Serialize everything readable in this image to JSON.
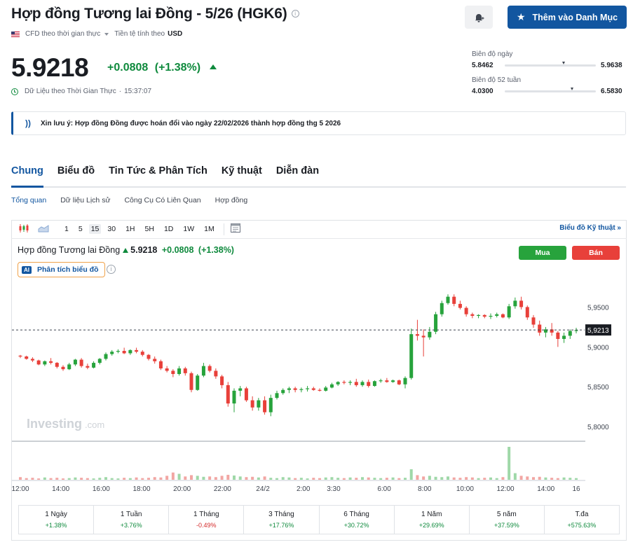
{
  "header": {
    "title": "Hợp đồng Tương lai Đồng - 5/26 (HGK6)",
    "source_label": "CFD theo thời gian thực",
    "currency_label": "Tiền tệ tính theo",
    "currency": "USD",
    "watchlist_button": "Thêm vào Danh Mục"
  },
  "quote": {
    "price": "5.9218",
    "change": "+0.0808",
    "change_pct": "(+1.38%)",
    "realtime_label": "Dữ Liệu theo Thời Gian Thực",
    "time": "15:37:07"
  },
  "ranges": {
    "day": {
      "label": "Biên độ ngày",
      "low": "5.8462",
      "high": "5.9638",
      "current_fraction": 0.65
    },
    "week52": {
      "label": "Biên độ 52 tuần",
      "low": "4.0300",
      "high": "6.5830",
      "current_fraction": 0.74
    }
  },
  "notice": {
    "text": "Xin lưu ý: Hợp đồng Đồng được hoán đổi vào ngày 22/02/2026 thành hợp đồng thg 5 2026"
  },
  "tabs": [
    "Chung",
    "Biểu đồ",
    "Tin Tức & Phân Tích",
    "Kỹ thuật",
    "Diễn đàn"
  ],
  "subtabs": [
    "Tổng quan",
    "Dữ liệu Lịch sử",
    "Công Cụ Có Liên Quan",
    "Hợp đồng"
  ],
  "toolbar": {
    "intervals": [
      "1",
      "5",
      "15",
      "30",
      "1H",
      "5H",
      "1D",
      "1W",
      "1M"
    ],
    "selected_interval": "15",
    "tech_chart_link": "Biểu đồ Kỹ thuật"
  },
  "chart_header": {
    "name": "Hợp đồng Tương lai Đồng",
    "price": "5.9218",
    "change": "+0.0808",
    "change_pct": "(+1.38%)",
    "buy": "Mua",
    "sell": "Bán",
    "ai_badge": "AI",
    "ai_label": "Phân tích biểu đồ",
    "watermark": "Investing",
    "watermark_suffix": ".com"
  },
  "chart_data": {
    "type": "candlestick",
    "interval": "15",
    "y_ticks": [
      "5,9500",
      "5,9000",
      "5,8500",
      "5,8000"
    ],
    "ylim": [
      5.786,
      5.975
    ],
    "x_ticks": [
      "12:00",
      "14:00",
      "16:00",
      "18:00",
      "20:00",
      "22:00",
      "24/2",
      "2:00",
      "3:30",
      "6:00",
      "8:00",
      "10:00",
      "12:00",
      "14:00",
      "16"
    ],
    "x_tick_positions": [
      0,
      4,
      8,
      12,
      16,
      20,
      24,
      28,
      31,
      36,
      40,
      44,
      48,
      52,
      55
    ],
    "current_price_label": "5,9213",
    "current_price": 5.9213,
    "candles": [
      [
        5.889,
        5.89,
        5.886,
        5.888
      ],
      [
        5.888,
        5.889,
        5.884,
        5.885
      ],
      [
        5.885,
        5.887,
        5.881,
        5.883
      ],
      [
        5.883,
        5.884,
        5.877,
        5.878
      ],
      [
        5.878,
        5.883,
        5.876,
        5.882
      ],
      [
        5.882,
        5.886,
        5.878,
        5.88
      ],
      [
        5.88,
        5.881,
        5.873,
        5.875
      ],
      [
        5.875,
        5.877,
        5.87,
        5.872
      ],
      [
        5.872,
        5.88,
        5.871,
        5.878
      ],
      [
        5.878,
        5.885,
        5.876,
        5.884
      ],
      [
        5.884,
        5.886,
        5.874,
        5.876
      ],
      [
        5.876,
        5.879,
        5.872,
        5.874
      ],
      [
        5.874,
        5.882,
        5.873,
        5.88
      ],
      [
        5.88,
        5.886,
        5.878,
        5.885
      ],
      [
        5.885,
        5.893,
        5.883,
        5.891
      ],
      [
        5.891,
        5.896,
        5.889,
        5.894
      ],
      [
        5.894,
        5.897,
        5.892,
        5.895
      ],
      [
        5.895,
        5.899,
        5.891,
        5.892
      ],
      [
        5.892,
        5.897,
        5.89,
        5.896
      ],
      [
        5.896,
        5.899,
        5.892,
        5.894
      ],
      [
        5.894,
        5.896,
        5.888,
        5.89
      ],
      [
        5.89,
        5.891,
        5.883,
        5.885
      ],
      [
        5.885,
        5.888,
        5.879,
        5.882
      ],
      [
        5.882,
        5.884,
        5.871,
        5.873
      ],
      [
        5.873,
        5.876,
        5.868,
        5.87
      ],
      [
        5.87,
        5.872,
        5.862,
        5.866
      ],
      [
        5.866,
        5.876,
        5.864,
        5.873
      ],
      [
        5.873,
        5.875,
        5.864,
        5.867
      ],
      [
        5.867,
        5.869,
        5.843,
        5.846
      ],
      [
        5.846,
        5.866,
        5.845,
        5.864
      ],
      [
        5.864,
        5.88,
        5.862,
        5.876
      ],
      [
        5.876,
        5.878,
        5.868,
        5.87
      ],
      [
        5.87,
        5.873,
        5.86,
        5.863
      ],
      [
        5.863,
        5.865,
        5.848,
        5.852
      ],
      [
        5.852,
        5.856,
        5.825,
        5.829
      ],
      [
        5.829,
        5.848,
        5.818,
        5.845
      ],
      [
        5.845,
        5.851,
        5.838,
        5.848
      ],
      [
        5.848,
        5.85,
        5.831,
        5.833
      ],
      [
        5.833,
        5.838,
        5.82,
        5.824
      ],
      [
        5.824,
        5.836,
        5.82,
        5.833
      ],
      [
        5.833,
        5.838,
        5.815,
        5.818
      ],
      [
        5.818,
        5.84,
        5.813,
        5.836
      ],
      [
        5.836,
        5.845,
        5.834,
        5.842
      ],
      [
        5.842,
        5.848,
        5.84,
        5.846
      ],
      [
        5.846,
        5.85,
        5.842,
        5.848
      ],
      [
        5.848,
        5.85,
        5.843,
        5.846
      ],
      [
        5.846,
        5.849,
        5.843,
        5.847
      ],
      [
        5.847,
        5.851,
        5.844,
        5.848
      ],
      [
        5.848,
        5.85,
        5.845,
        5.846
      ],
      [
        5.846,
        5.848,
        5.844,
        5.845
      ],
      [
        5.845,
        5.851,
        5.844,
        5.849
      ],
      [
        5.849,
        5.855,
        5.848,
        5.853
      ],
      [
        5.853,
        5.857,
        5.851,
        5.856
      ],
      [
        5.856,
        5.858,
        5.853,
        5.855
      ],
      [
        5.855,
        5.858,
        5.852,
        5.856
      ],
      [
        5.856,
        5.86,
        5.85,
        5.852
      ],
      [
        5.852,
        5.858,
        5.85,
        5.856
      ],
      [
        5.856,
        5.859,
        5.849,
        5.851
      ],
      [
        5.851,
        5.858,
        5.85,
        5.857
      ],
      [
        5.857,
        5.86,
        5.855,
        5.858
      ],
      [
        5.858,
        5.861,
        5.855,
        5.856
      ],
      [
        5.856,
        5.859,
        5.855,
        5.858
      ],
      [
        5.858,
        5.859,
        5.852,
        5.853
      ],
      [
        5.853,
        5.863,
        5.848,
        5.861
      ],
      [
        5.861,
        5.923,
        5.859,
        5.916
      ],
      [
        5.916,
        5.934,
        5.908,
        5.914
      ],
      [
        5.914,
        5.922,
        5.888,
        5.912
      ],
      [
        5.912,
        5.925,
        5.909,
        5.919
      ],
      [
        5.919,
        5.944,
        5.916,
        5.941
      ],
      [
        5.941,
        5.958,
        5.938,
        5.955
      ],
      [
        5.955,
        5.966,
        5.953,
        5.963
      ],
      [
        5.963,
        5.966,
        5.951,
        5.954
      ],
      [
        5.954,
        5.958,
        5.947,
        5.949
      ],
      [
        5.949,
        5.951,
        5.938,
        5.941
      ],
      [
        5.941,
        5.943,
        5.936,
        5.939
      ],
      [
        5.939,
        5.941,
        5.936,
        5.94
      ],
      [
        5.94,
        5.941,
        5.936,
        5.938
      ],
      [
        5.938,
        5.942,
        5.935,
        5.939
      ],
      [
        5.939,
        5.943,
        5.937,
        5.941
      ],
      [
        5.941,
        5.942,
        5.936,
        5.937
      ],
      [
        5.937,
        5.954,
        5.935,
        5.951
      ],
      [
        5.951,
        5.962,
        5.948,
        5.958
      ],
      [
        5.958,
        5.963,
        5.947,
        5.95
      ],
      [
        5.95,
        5.952,
        5.934,
        5.937
      ],
      [
        5.937,
        5.94,
        5.924,
        5.928
      ],
      [
        5.928,
        5.933,
        5.914,
        5.918
      ],
      [
        5.918,
        5.925,
        5.912,
        5.922
      ],
      [
        5.922,
        5.93,
        5.914,
        5.918
      ],
      [
        5.918,
        5.92,
        5.9,
        5.91
      ],
      [
        5.91,
        5.918,
        5.905,
        5.914
      ],
      [
        5.914,
        5.922,
        5.91,
        5.92
      ],
      [
        5.92,
        5.924,
        5.917,
        5.921
      ]
    ],
    "volume": [
      0.08,
      0.05,
      0.06,
      0.04,
      0.07,
      0.05,
      0.06,
      0.04,
      0.05,
      0.07,
      0.06,
      0.05,
      0.04,
      0.06,
      0.08,
      0.05,
      0.04,
      0.06,
      0.05,
      0.07,
      0.05,
      0.06,
      0.08,
      0.07,
      0.12,
      0.22,
      0.18,
      0.1,
      0.14,
      0.12,
      0.09,
      0.1,
      0.08,
      0.12,
      0.15,
      0.13,
      0.1,
      0.08,
      0.09,
      0.07,
      0.1,
      0.06,
      0.05,
      0.08,
      0.07,
      0.05,
      0.06,
      0.04,
      0.06,
      0.05,
      0.07,
      0.08,
      0.06,
      0.05,
      0.07,
      0.06,
      0.08,
      0.07,
      0.06,
      0.05,
      0.06,
      0.07,
      0.05,
      0.06,
      0.32,
      0.14,
      0.1,
      0.12,
      0.09,
      0.08,
      0.1,
      0.07,
      0.06,
      0.08,
      0.07,
      0.05,
      0.06,
      0.07,
      0.05,
      0.08,
      1.0,
      0.2,
      0.12,
      0.1,
      0.08,
      0.09,
      0.07,
      0.06,
      0.05,
      0.07,
      0.06,
      0.05
    ]
  },
  "performance": [
    {
      "label": "1 Ngày",
      "value": "+1.38%",
      "dir": "pos"
    },
    {
      "label": "1 Tuần",
      "value": "+3.76%",
      "dir": "pos"
    },
    {
      "label": "1 Tháng",
      "value": "-0.49%",
      "dir": "neg"
    },
    {
      "label": "3 Tháng",
      "value": "+17.76%",
      "dir": "pos"
    },
    {
      "label": "6 Tháng",
      "value": "+30.72%",
      "dir": "pos"
    },
    {
      "label": "1 Năm",
      "value": "+29.69%",
      "dir": "pos"
    },
    {
      "label": "5 năm",
      "value": "+37.59%",
      "dir": "pos"
    },
    {
      "label": "T.đa",
      "value": "+575.63%",
      "dir": "pos"
    }
  ],
  "colors": {
    "accent": "#1256a0",
    "up": "#27a33c",
    "down": "#e8403a",
    "positive_text": "#0f8a3d",
    "negative_text": "#d42a2a"
  },
  "icons": {
    "bell": "bell-plus-icon",
    "star": "star-icon",
    "rss": "rss-icon",
    "clock": "clock-icon",
    "info": "info-icon"
  }
}
